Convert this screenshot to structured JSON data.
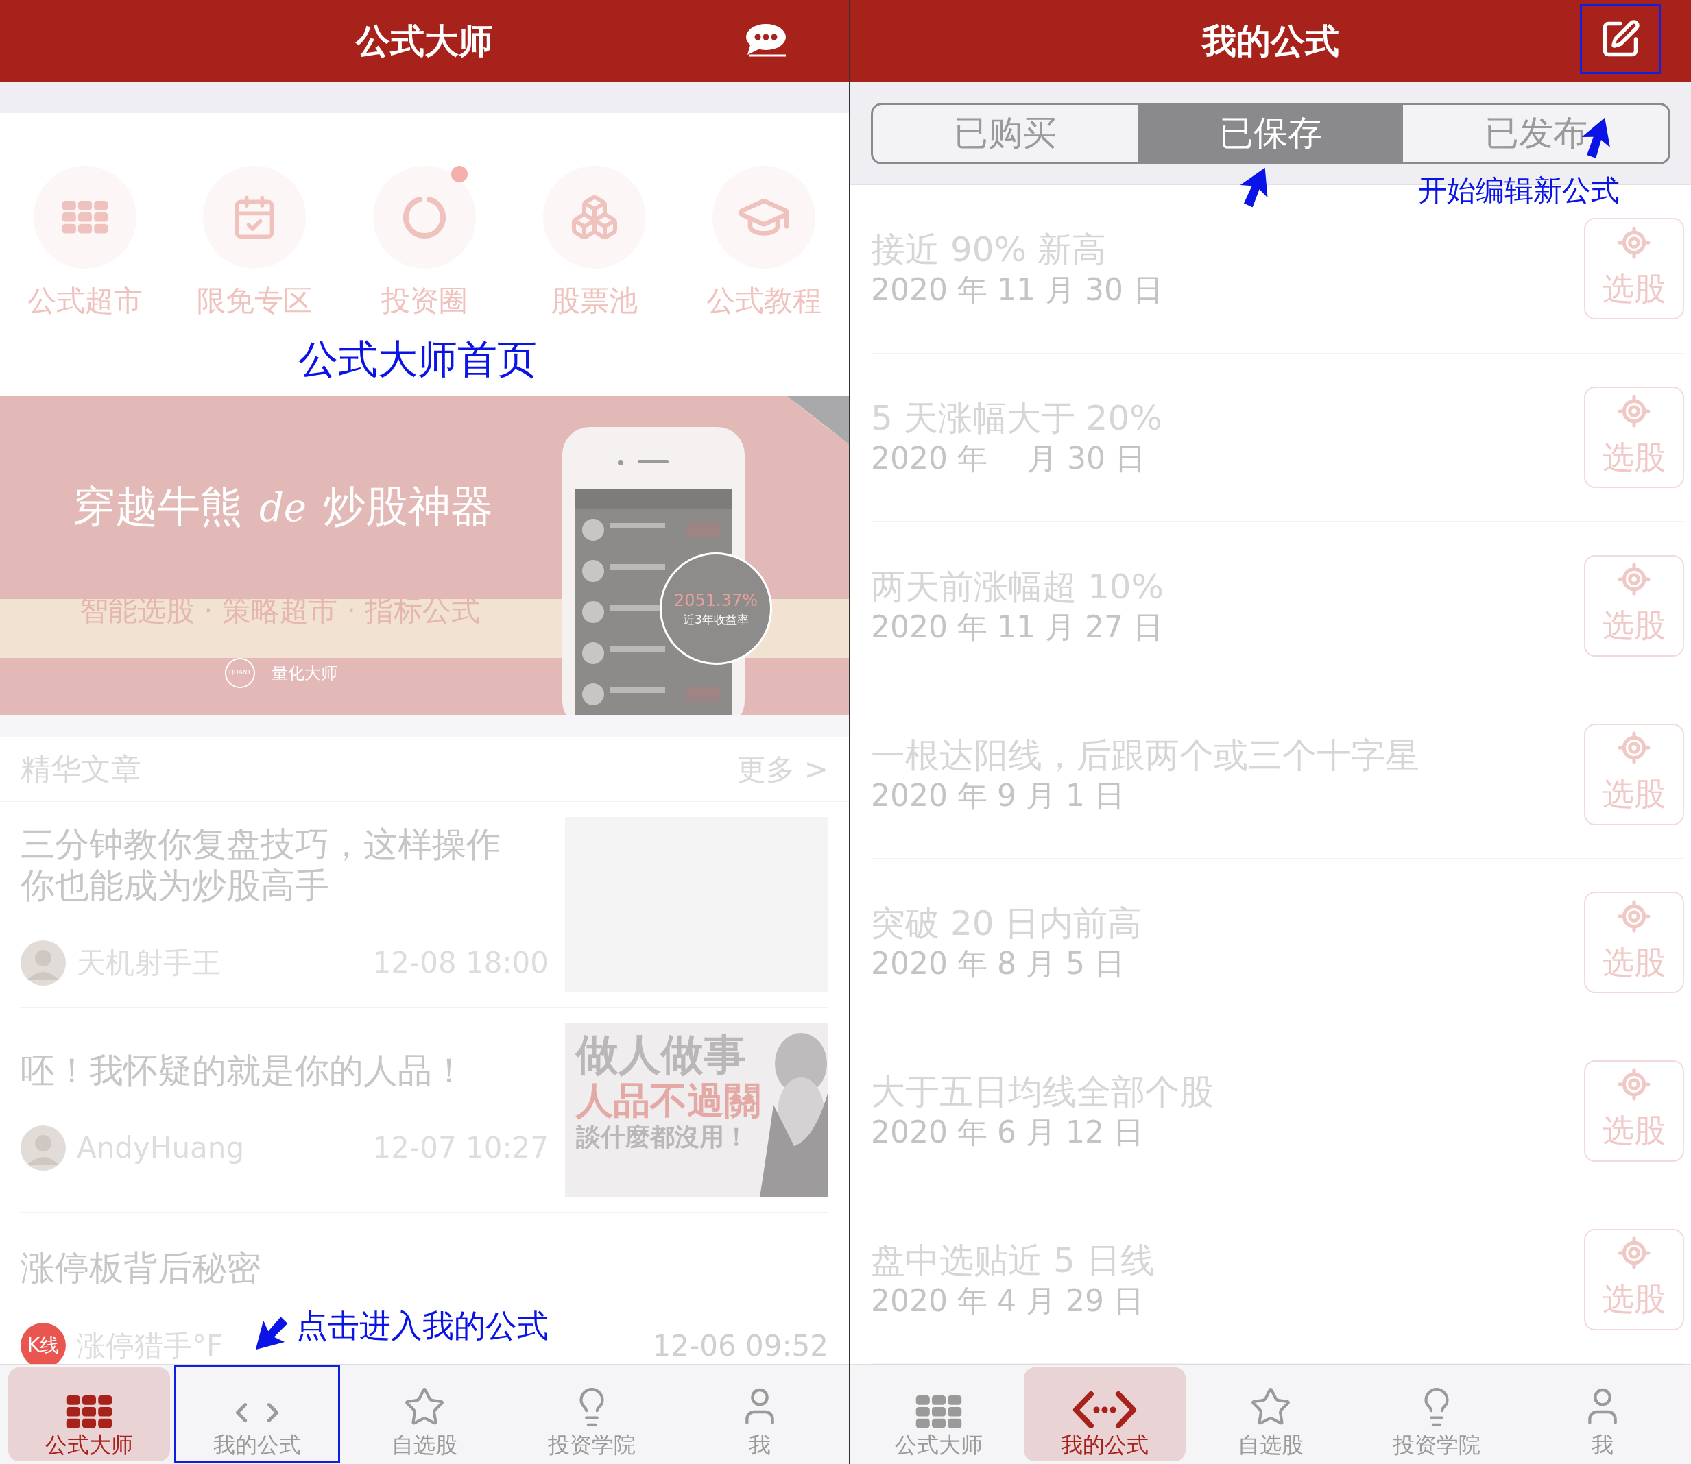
{
  "left_screen": {
    "header": {
      "title": "公式大师"
    },
    "quick_links": [
      {
        "label": "公式超市",
        "kind": "grid",
        "badge": false
      },
      {
        "label": "限免专区",
        "kind": "calendar",
        "badge": false
      },
      {
        "label": "投资圈",
        "kind": "ring",
        "badge": true
      },
      {
        "label": "股票池",
        "kind": "boxes",
        "badge": false
      },
      {
        "label": "公式教程",
        "kind": "cap",
        "badge": false
      }
    ],
    "banner": {
      "headline_start": "穿越牛熊",
      "headline_connector": "de",
      "headline_end": "炒股神器",
      "tagline": "智能选股 · 策略超市 · 指标公式",
      "brand": "量化大师",
      "logo_text": "QUANT",
      "stat_value": "2051.37%",
      "stat_label": "近3年收益率"
    },
    "articles_section": {
      "title": "精华文章",
      "more_link": "更多 >"
    },
    "articles": [
      {
        "title": "三分钟教你复盘技巧，这样操作你也能成为炒股高手",
        "author": "天机射手王",
        "time": "12-08 18:00",
        "thumbnail": {
          "kind": "blank"
        }
      },
      {
        "title": "呸！我怀疑的就是你的人品！",
        "author": "AndyHuang",
        "time": "12-07 10:27",
        "thumbnail": {
          "kind": "text_art",
          "lines": [
            "做人做事",
            "人品不過關",
            "談什麼都沒用！"
          ]
        }
      },
      {
        "title": "涨停板背后秘密",
        "author": "涨停猎手°F",
        "time": "12-06 09:52",
        "avatar": {
          "kind": "label",
          "text": "K线"
        }
      }
    ],
    "tab_bar": [
      {
        "label": "公式大师",
        "kind": "grid",
        "selected": true,
        "highlighted": false
      },
      {
        "label": "我的公式",
        "kind": "code",
        "selected": false,
        "highlighted": true
      },
      {
        "label": "自选股",
        "kind": "star",
        "selected": false,
        "highlighted": false
      },
      {
        "label": "投资学院",
        "kind": "bulb",
        "selected": false,
        "highlighted": false
      },
      {
        "label": "我",
        "kind": "person",
        "selected": false,
        "highlighted": false
      }
    ]
  },
  "right_screen": {
    "header": {
      "title": "我的公式",
      "edit_highlighted": true
    },
    "segments": [
      {
        "label": "已购买",
        "selected": false
      },
      {
        "label": "已保存",
        "selected": true
      },
      {
        "label": "已发布",
        "selected": false
      }
    ],
    "formulas": [
      {
        "name": "接近 90% 新高",
        "date": "2020 年 11 月 30 日",
        "action": "选股"
      },
      {
        "name": "5 天涨幅大于 20%",
        "date": "2020 年 　月 30 日",
        "action": "选股"
      },
      {
        "name": "两天前涨幅超 10%",
        "date": "2020 年 11 月 27 日",
        "action": "选股"
      },
      {
        "name": "一根达阳线，后跟两个或三个十字星",
        "date": "2020 年 9 月 1 日",
        "action": "选股"
      },
      {
        "name": "突破 20 日内前高",
        "date": "2020 年 8 月 5 日",
        "action": "选股"
      },
      {
        "name": "大于五日均线全部个股",
        "date": "2020 年 6 月 12 日",
        "action": "选股"
      },
      {
        "name": "盘中选贴近 5 日线",
        "date": "2020 年 4 月 29 日",
        "action": "选股"
      }
    ],
    "tab_bar": [
      {
        "label": "公式大师",
        "kind": "grid",
        "selected": false
      },
      {
        "label": "我的公式",
        "kind": "dotcode",
        "selected": true
      },
      {
        "label": "自选股",
        "kind": "star",
        "selected": false
      },
      {
        "label": "投资学院",
        "kind": "bulb",
        "selected": false
      },
      {
        "label": "我",
        "kind": "person",
        "selected": false
      }
    ]
  },
  "annotations": {
    "home_caption": "公式大师首页",
    "nav_caption": "点击进入我的公式",
    "edit_caption": "开始编辑新公式"
  }
}
